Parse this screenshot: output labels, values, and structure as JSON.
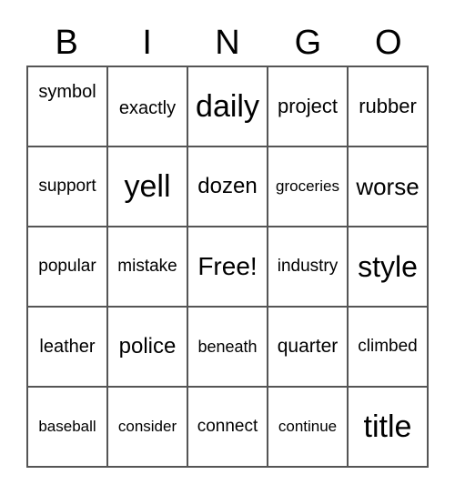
{
  "header": [
    "B",
    "I",
    "N",
    "G",
    "O"
  ],
  "cells": [
    [
      "symbol",
      "exactly",
      "daily",
      "project",
      "rubber"
    ],
    [
      "support",
      "yell",
      "dozen",
      "groceries",
      "worse"
    ],
    [
      "popular",
      "mistake",
      "Free!",
      "industry",
      "style"
    ],
    [
      "leather",
      "police",
      "beneath",
      "quarter",
      "climbed"
    ],
    [
      "baseball",
      "consider",
      "connect",
      "continue",
      "title"
    ]
  ]
}
